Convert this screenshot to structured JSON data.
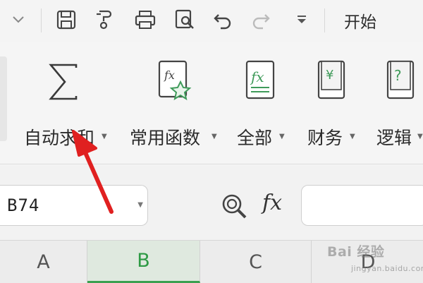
{
  "quick_access": {
    "items": [
      "collapse-chevron",
      "save-icon",
      "format-painter-icon",
      "print-icon",
      "print-preview-icon",
      "undo-icon",
      "redo-icon",
      "more-dropdown-icon"
    ],
    "active_tab": "开始"
  },
  "ribbon": {
    "groups": [
      {
        "label": "自动求和",
        "icon": "sum-icon"
      },
      {
        "label": "常用函数",
        "icon": "common-functions-icon"
      },
      {
        "label": "全部",
        "icon": "all-functions-icon"
      },
      {
        "label": "财务",
        "icon": "finance-icon"
      },
      {
        "label": "逻辑",
        "icon": "logic-icon"
      }
    ]
  },
  "formula_bar": {
    "name_box_value": "B74",
    "fx_symbol": "fx",
    "formula_value": ""
  },
  "columns": [
    {
      "label": "A",
      "active": false
    },
    {
      "label": "B",
      "active": true
    },
    {
      "label": "C",
      "active": false
    },
    {
      "label": "D",
      "active": false
    }
  ],
  "watermark": {
    "line1": "Bai 经验",
    "line2": "jingyan.baidu.com"
  },
  "colors": {
    "accent_green": "#2e9a45",
    "annotation_red": "#e02020",
    "icon_green": "#3f9b5a"
  }
}
